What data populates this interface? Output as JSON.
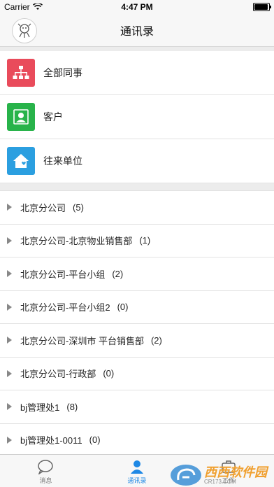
{
  "status": {
    "carrier": "Carrier",
    "time": "4:47 PM"
  },
  "nav": {
    "title": "通讯录"
  },
  "shortcuts": [
    {
      "label": "全部同事",
      "icon": "org-chart-icon",
      "color": "#e94b5b"
    },
    {
      "label": "客户",
      "icon": "person-icon",
      "color": "#28b34a"
    },
    {
      "label": "往来单位",
      "icon": "home-heart-icon",
      "color": "#2b9fe0"
    }
  ],
  "groups": [
    {
      "name": "北京分公司",
      "count": "(5)"
    },
    {
      "name": "北京分公司-北京物业销售部",
      "count": "(1)"
    },
    {
      "name": "北京分公司-平台小组",
      "count": "(2)"
    },
    {
      "name": "北京分公司-平台小组2",
      "count": "(0)"
    },
    {
      "name": "北京分公司-深圳市 平台销售部",
      "count": "(2)"
    },
    {
      "name": "北京分公司-行政部",
      "count": "(0)"
    },
    {
      "name": "bj管理处1",
      "count": "(8)"
    },
    {
      "name": "bj管理处1-0011",
      "count": "(0)"
    }
  ],
  "tabs": [
    {
      "label": "消息",
      "icon": "chat-bubble-icon",
      "active": false
    },
    {
      "label": "通讯录",
      "icon": "contacts-icon",
      "active": true
    },
    {
      "label": "工作",
      "icon": "work-icon",
      "active": false
    }
  ],
  "watermark": {
    "text": "西西软件园",
    "sub": "CR173.COM"
  }
}
